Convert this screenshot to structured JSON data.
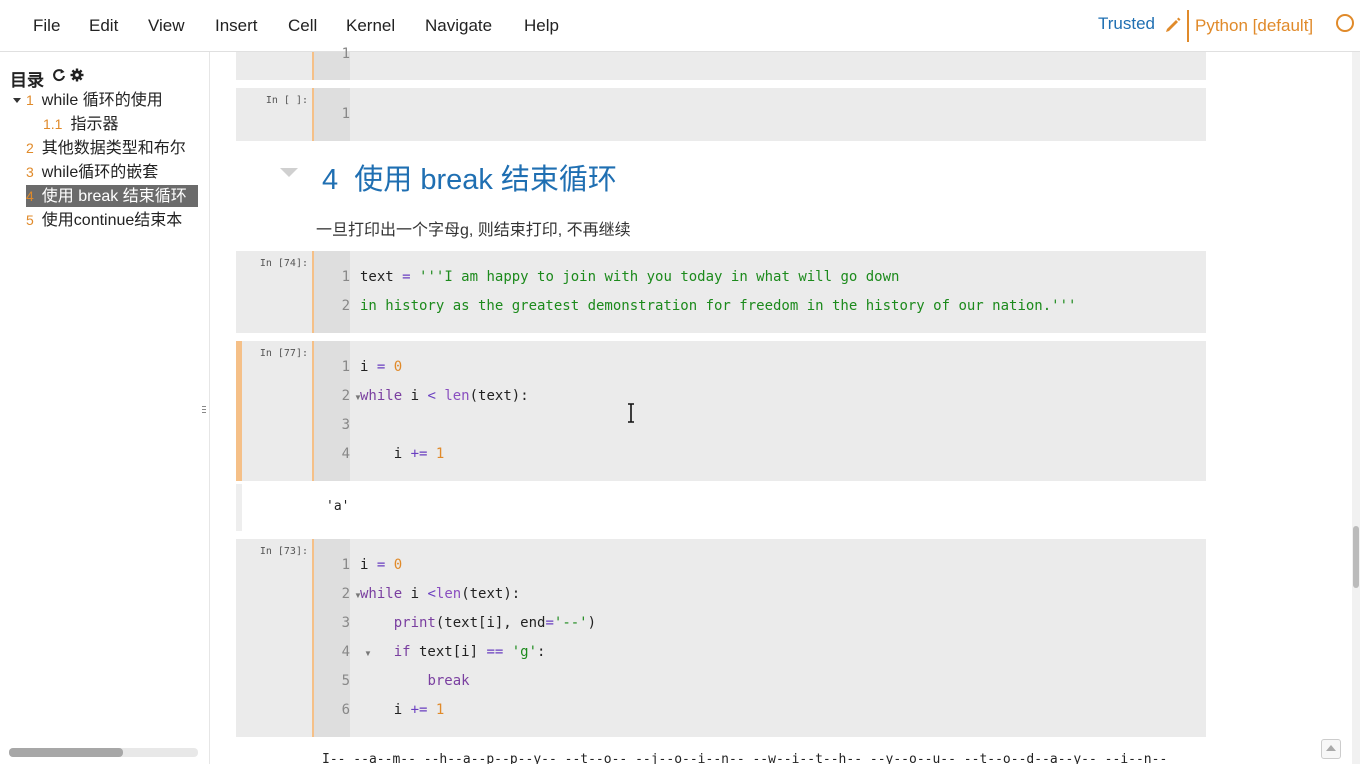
{
  "menu": [
    "File",
    "Edit",
    "View",
    "Insert",
    "Cell",
    "Kernel",
    "Navigate",
    "Help"
  ],
  "status": {
    "trusted": "Trusted",
    "kernel": "Python [default]"
  },
  "toc": {
    "title": "目录",
    "items": [
      {
        "num": "1",
        "label": "while 循环的使用"
      },
      {
        "num": "1.1",
        "label": "指示器"
      },
      {
        "num": "2",
        "label": "其他数据类型和布尔"
      },
      {
        "num": "3",
        "label": "while循环的嵌套"
      },
      {
        "num": "4",
        "label": "使用 break 结束循环"
      },
      {
        "num": "5",
        "label": "使用continue结束本"
      }
    ]
  },
  "cells": {
    "top_partial": {
      "line": "1"
    },
    "empty_cell": {
      "prompt": "In [ ]:",
      "line": "1"
    },
    "heading": {
      "num": "4",
      "text": "使用 break 结束循环"
    },
    "markdown": "一旦打印出一个字母g, 则结束打印, 不再继续",
    "cell74": {
      "prompt": "In [74]:",
      "lines": [
        "text = '''I am happy to join with you today in what will go down",
        "in history as the greatest demonstration for freedom in the history of our nation.'''"
      ]
    },
    "cell77": {
      "prompt": "In [77]:",
      "lines": [
        "i = 0",
        "while i < len(text):",
        "",
        "    i += 1"
      ],
      "output": "'a'"
    },
    "cell73": {
      "prompt": "In [73]:",
      "lines": [
        "i = 0",
        "while i <len(text):",
        "    print(text[i], end='--')",
        "    if text[i] == 'g':",
        "        break",
        "    i += 1"
      ],
      "output": "I-- --a--m-- --h--a--p--p--y-- --t--o-- --j--o--i--n-- --w--i--t--h-- --y--o--u-- --t--o--d--a--y-- --i--n--"
    }
  }
}
